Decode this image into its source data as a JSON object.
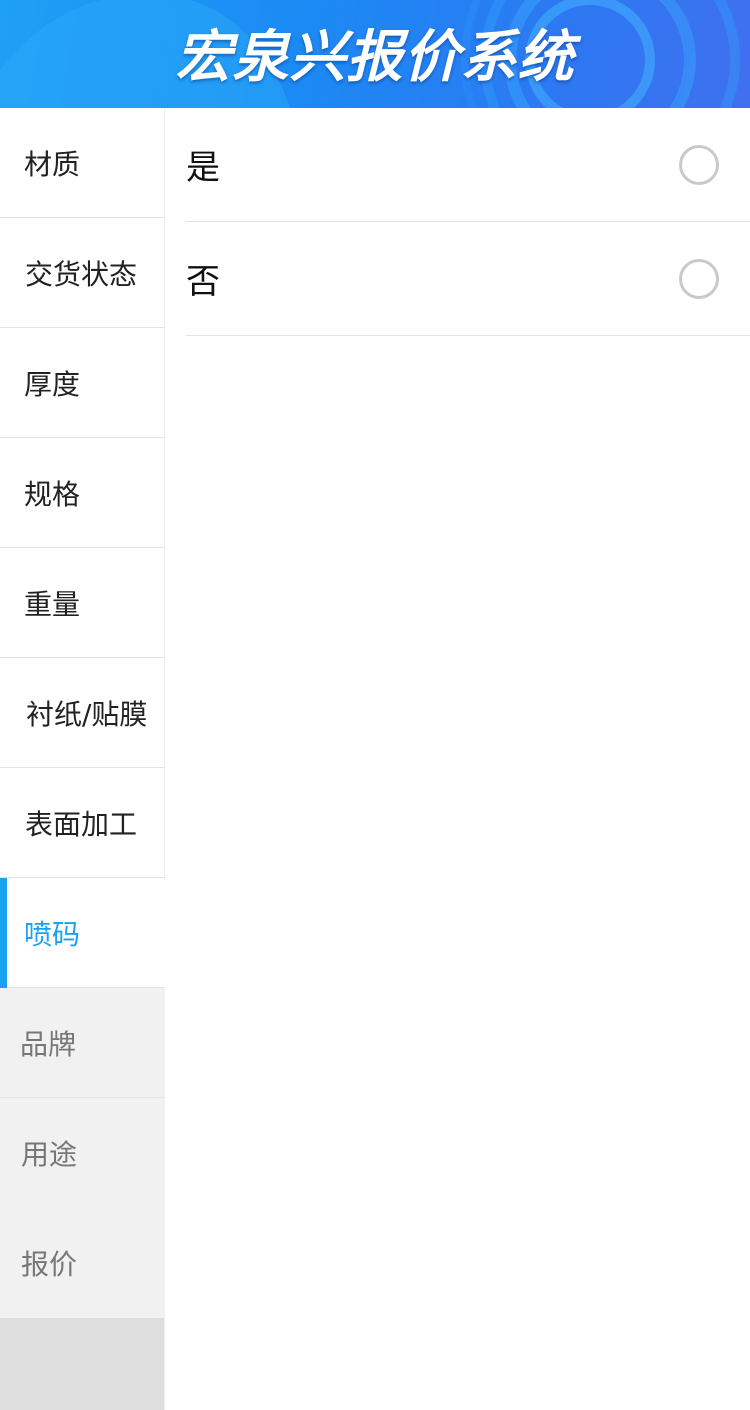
{
  "header": {
    "title": "宏泉兴报价系统"
  },
  "sidebar": {
    "items": [
      {
        "label": "材质",
        "state": "normal"
      },
      {
        "label": "交货状态",
        "state": "normal"
      },
      {
        "label": "厚度",
        "state": "normal"
      },
      {
        "label": "规格",
        "state": "normal"
      },
      {
        "label": "重量",
        "state": "normal"
      },
      {
        "label": "衬纸/贴膜",
        "state": "normal"
      },
      {
        "label": "表面加工",
        "state": "normal"
      },
      {
        "label": "喷码",
        "state": "active"
      },
      {
        "label": "品牌",
        "state": "inactive"
      },
      {
        "label": "用途",
        "state": "inactive"
      },
      {
        "label": "报价",
        "state": "inactive"
      }
    ]
  },
  "options": [
    {
      "label": "是",
      "selected": false
    },
    {
      "label": "否",
      "selected": false
    }
  ],
  "colors": {
    "accent": "#1aa1ef",
    "header_gradient_start": "#1ea0f5",
    "header_gradient_end": "#3f70ef",
    "sidebar_inactive_bg": "#f1f1f1",
    "radio_border": "#c9c9c9"
  }
}
